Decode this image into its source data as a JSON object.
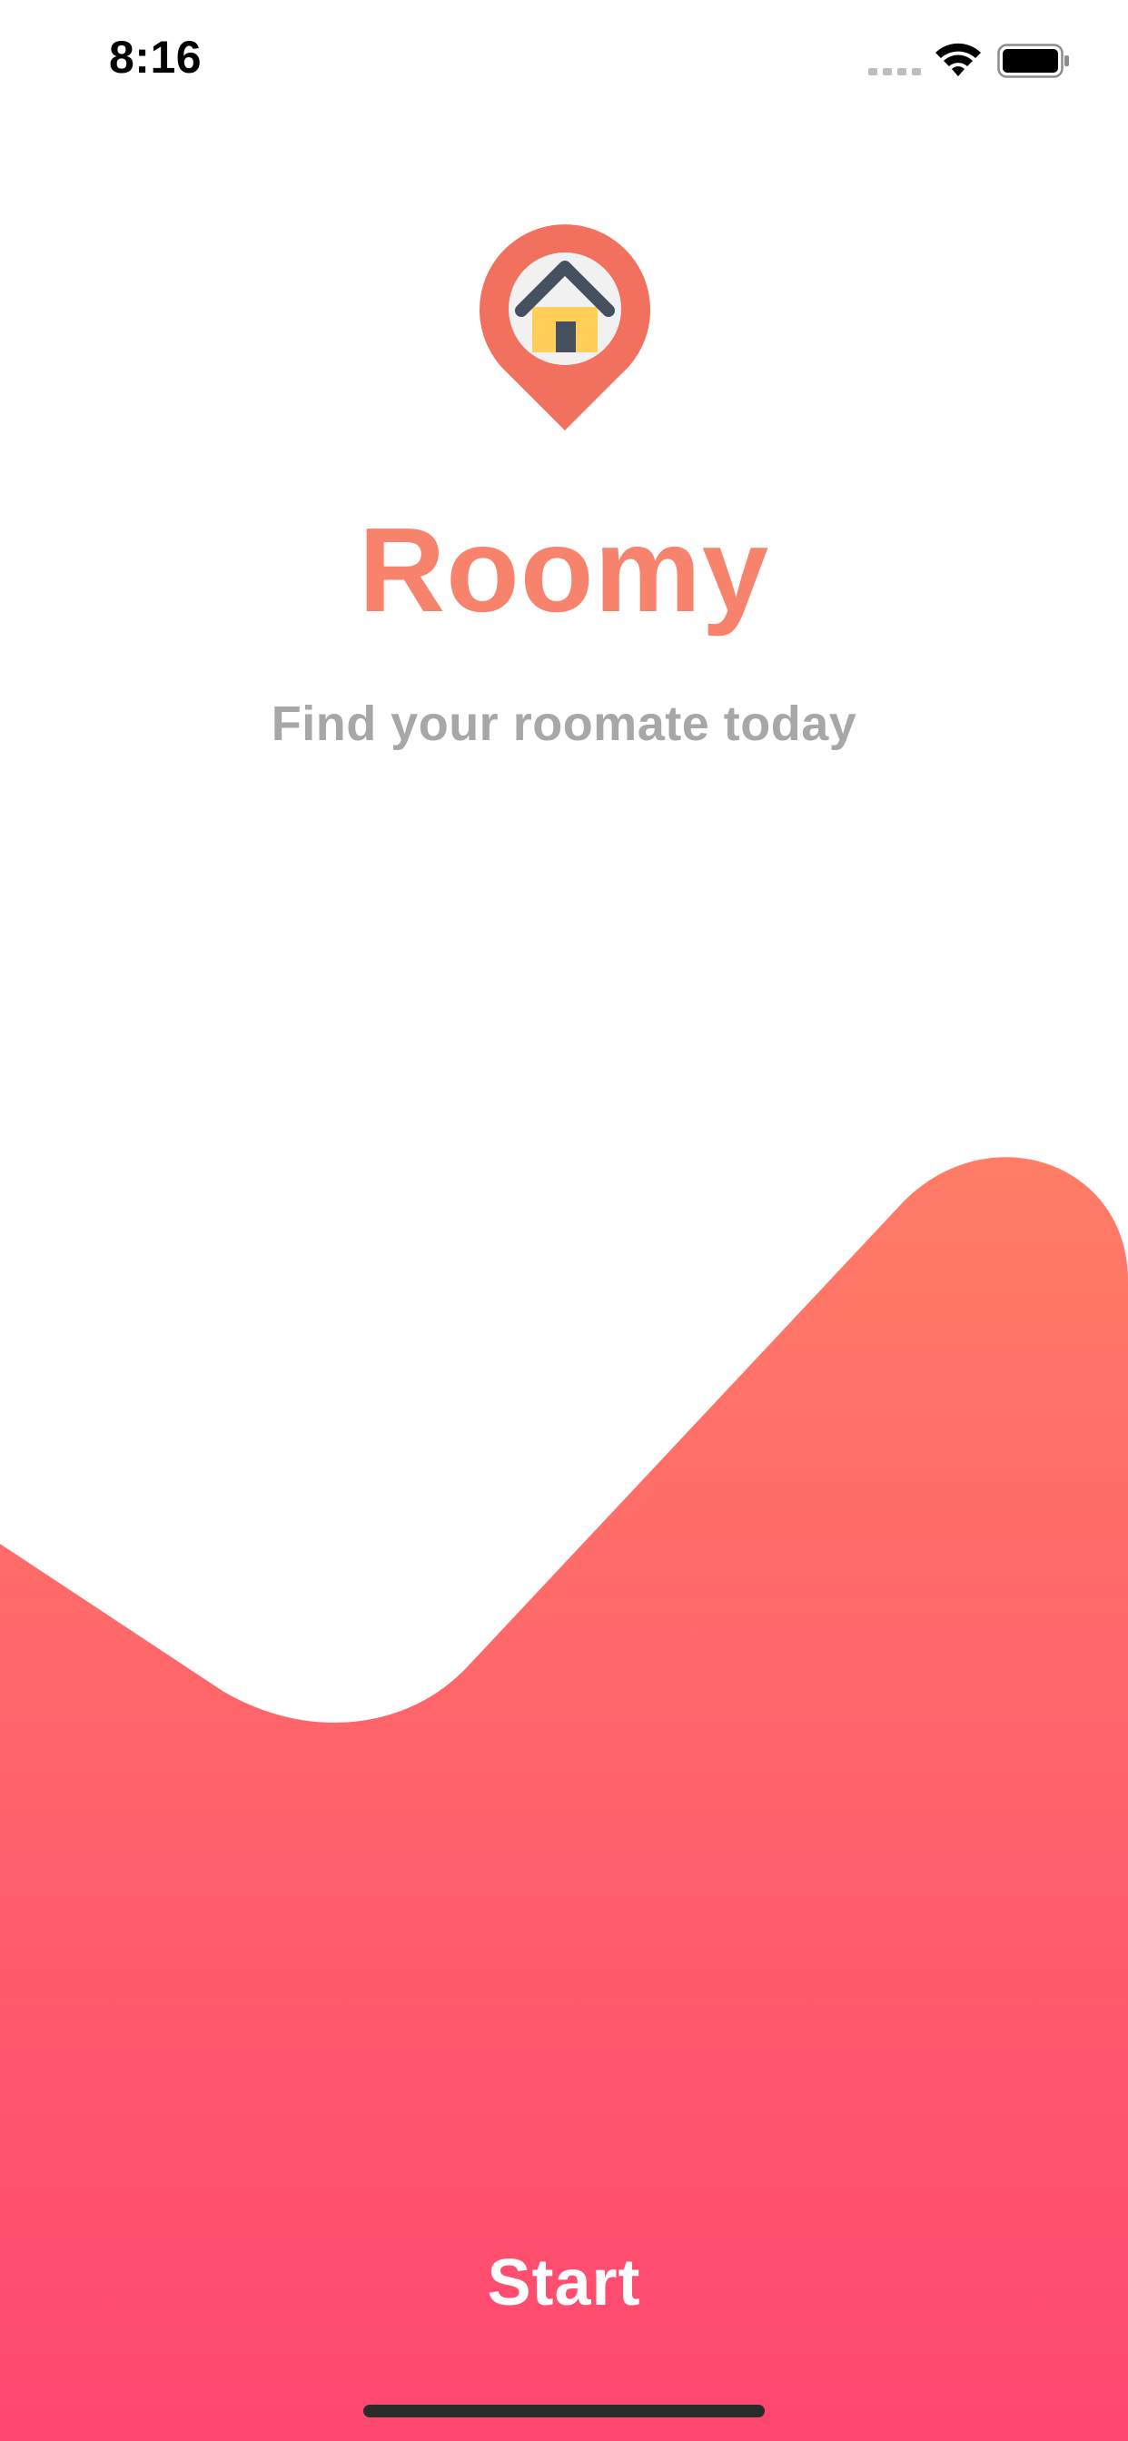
{
  "status_bar": {
    "time": "8:16"
  },
  "app": {
    "title": "Roomy",
    "subtitle": "Find your roomate today",
    "logo_icon": "map-pin-house-icon"
  },
  "actions": {
    "start_label": "Start"
  },
  "colors": {
    "accent": "#F7836C",
    "subtitle": "#A7A7A7",
    "gradient_top": "#FF7C66",
    "gradient_bottom": "#FF4770",
    "pin": "#F2705E",
    "pin_inner": "#F1F1F1",
    "house_body": "#FFCF5A",
    "house_roof": "#44505E"
  }
}
